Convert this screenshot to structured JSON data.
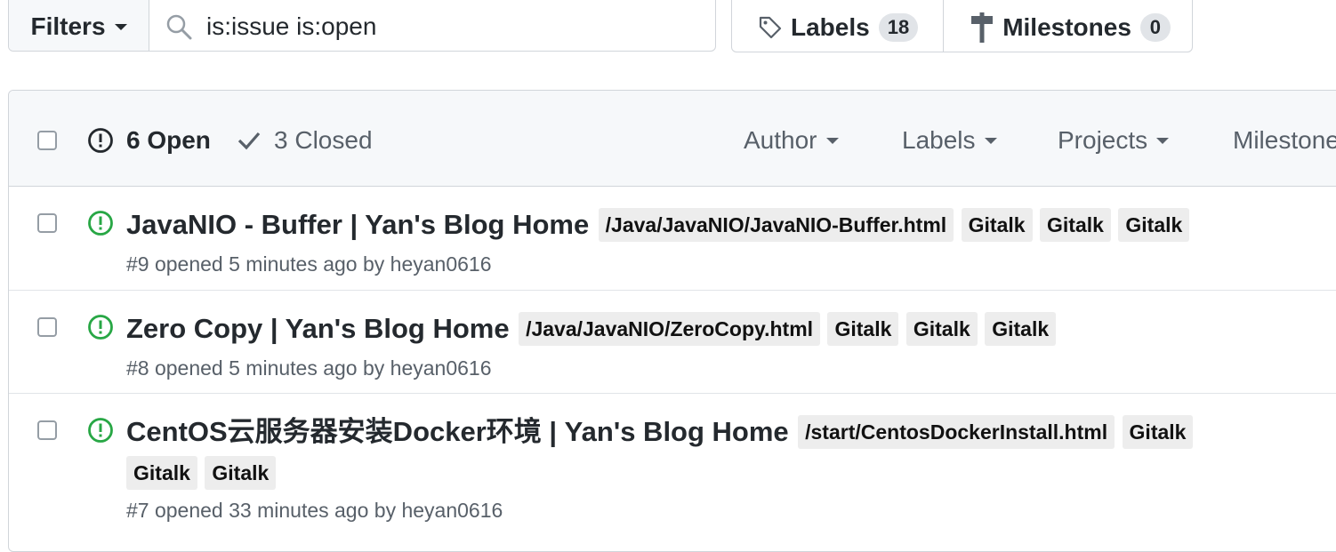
{
  "filters": {
    "label": "Filters",
    "search_value": "is:issue is:open"
  },
  "nav": {
    "labels_label": "Labels",
    "labels_count": "18",
    "milestones_label": "Milestones",
    "milestones_count": "0"
  },
  "states": {
    "open": "6 Open",
    "closed": "3 Closed"
  },
  "header_filters": [
    "Author",
    "Labels",
    "Projects",
    "Milestones"
  ],
  "issues": [
    {
      "title": "JavaNIO - Buffer | Yan's Blog Home",
      "labels": [
        "/Java/JavaNIO/JavaNIO-Buffer.html",
        "Gitalk",
        "Gitalk",
        "Gitalk"
      ],
      "meta": "#9 opened 5 minutes ago by heyan0616"
    },
    {
      "title": "Zero Copy | Yan's Blog Home",
      "labels": [
        "/Java/JavaNIO/ZeroCopy.html",
        "Gitalk",
        "Gitalk",
        "Gitalk"
      ],
      "meta": "#8 opened 5 minutes ago by heyan0616"
    },
    {
      "title": "CentOS云服务器安装Docker环境 | Yan's Blog Home",
      "labels": [
        "/start/CentosDockerInstall.html",
        "Gitalk",
        "Gitalk",
        "Gitalk"
      ],
      "meta": "#7 opened 33 minutes ago by heyan0616"
    }
  ],
  "colors": {
    "open_icon": "#28a745",
    "border": "#d1d5da",
    "header_bg": "#f6f8fa",
    "label_bg": "#ededed"
  }
}
